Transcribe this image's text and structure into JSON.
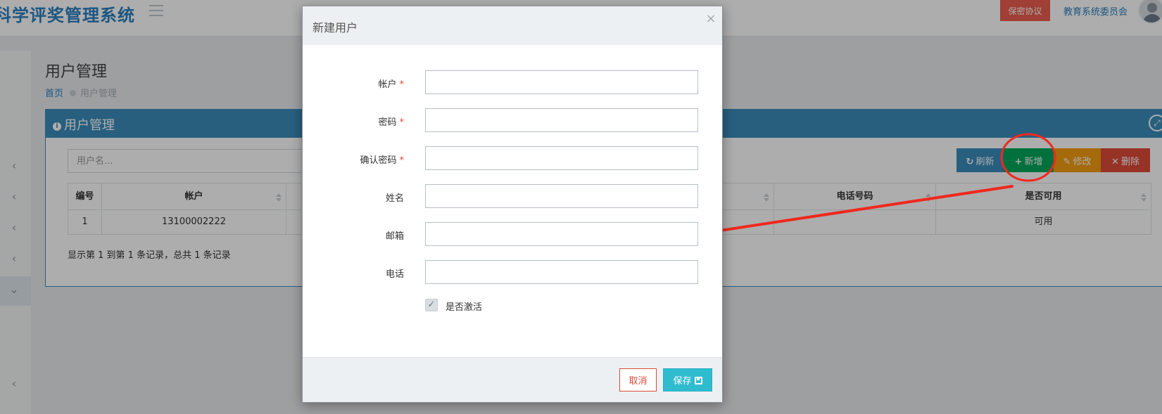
{
  "header": {
    "brand": "科学评奖管理系统",
    "confidential_btn": "保密协议",
    "org_name": "教育系统委员会"
  },
  "page": {
    "title": "用户管理",
    "breadcrumb": {
      "home": "首页",
      "current": "用户管理"
    }
  },
  "panel": {
    "title": "用户管理",
    "search_placeholder": "用户名...",
    "toolbar": {
      "refresh": "刷新",
      "add": "新增",
      "edit": "修改",
      "delete": "删除"
    },
    "table": {
      "headers": [
        "编号",
        "帐户",
        "",
        "电话号码",
        "是否可用"
      ],
      "rows": [
        [
          "1",
          "13100002222",
          "",
          "",
          "可用"
        ]
      ]
    },
    "page_info": "显示第 1 到第 1 条记录，总共 1 条记录"
  },
  "modal": {
    "title": "新建用户",
    "close": "×",
    "fields": {
      "account": {
        "label": "帐户",
        "required": "*",
        "value": ""
      },
      "password": {
        "label": "密码",
        "required": "*",
        "value": ""
      },
      "confirm_password": {
        "label": "确认密码",
        "required": "*",
        "value": ""
      },
      "name": {
        "label": "姓名",
        "value": ""
      },
      "email": {
        "label": "邮箱",
        "value": ""
      },
      "phone": {
        "label": "电话",
        "value": ""
      }
    },
    "active_checkbox": {
      "label": "是否激活",
      "checked": true,
      "mark": "✓"
    },
    "buttons": {
      "cancel": "取消",
      "save": "保存"
    }
  },
  "colors": {
    "brand": "#2b7fc0",
    "panel_header": "#3c8dbc",
    "add": "#00a65a",
    "edit": "#f39c12",
    "delete": "#dd4b39",
    "save": "#30bccf",
    "annotation": "#f0281e"
  },
  "icons": {
    "refresh": "refresh-icon",
    "add": "plus-icon",
    "edit": "edit-icon",
    "delete": "close-icon",
    "save": "save-icon",
    "info": "info-icon",
    "expand": "expand-icon"
  }
}
